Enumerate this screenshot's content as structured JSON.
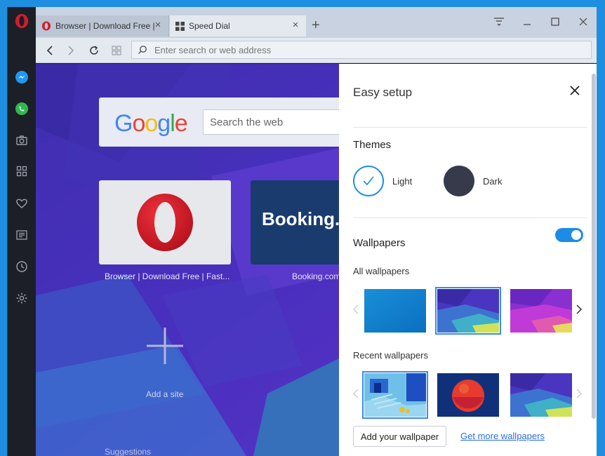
{
  "tabs": [
    {
      "label": "Browser | Download Free |",
      "active": false
    },
    {
      "label": "Speed Dial",
      "active": true
    }
  ],
  "toolbar": {
    "address_placeholder": "Enter search or web address"
  },
  "speed_dial": {
    "search_placeholder": "Search the web",
    "google_letters": [
      "G",
      "o",
      "o",
      "g",
      "l",
      "e"
    ],
    "tiles": [
      {
        "label": "Browser | Download Free | Fast...",
        "text": ""
      },
      {
        "label": "Booking.com",
        "text": "Booking.c"
      }
    ],
    "add_site_label": "Add a site",
    "suggestions_label": "Suggestions"
  },
  "easy_setup": {
    "title": "Easy setup",
    "themes_title": "Themes",
    "theme_light": "Light",
    "theme_dark": "Dark",
    "wallpapers_title": "Wallpapers",
    "wallpapers_enabled": true,
    "all_wallpapers_label": "All wallpapers",
    "recent_wallpapers_label": "Recent wallpapers",
    "add_wallpaper_button": "Add your wallpaper",
    "get_more_link": "Get more wallpapers"
  },
  "colors": {
    "accent": "#1e8be6",
    "opera_red": "#d01e2a",
    "booking_blue": "#1a3b6e",
    "dark_theme": "#363a4a"
  },
  "icons": [
    "opera-logo-icon",
    "messenger-icon",
    "whatsapp-icon",
    "camera-icon",
    "speed-dial-icon",
    "heart-icon",
    "news-icon",
    "history-icon",
    "settings-icon"
  ]
}
